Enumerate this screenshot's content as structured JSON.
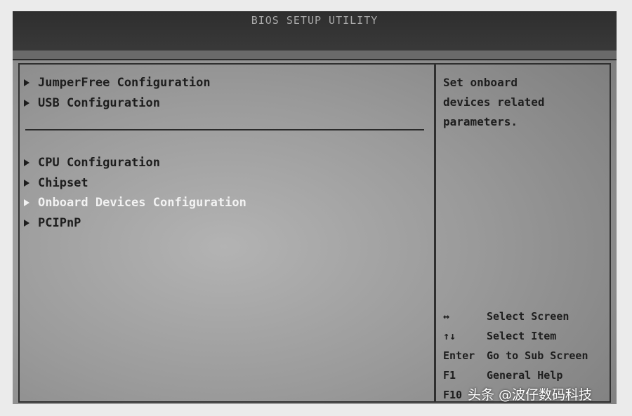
{
  "title": "BIOS SETUP UTILITY",
  "menu": {
    "group1": [
      {
        "label": "JumperFree Configuration"
      },
      {
        "label": "USB Configuration"
      }
    ],
    "group2": [
      {
        "label": "CPU Configuration"
      },
      {
        "label": "Chipset"
      },
      {
        "label": "Onboard Devices Configuration",
        "selected": true
      },
      {
        "label": "PCIPnP"
      }
    ]
  },
  "help": {
    "text": "Set onboard\ndevices related\nparameters."
  },
  "keys": [
    {
      "key": "↔",
      "action": "Select Screen"
    },
    {
      "key": "↑↓",
      "action": "Select Item"
    },
    {
      "key": "Enter",
      "action": "Go to Sub Screen"
    },
    {
      "key": "F1",
      "action": "General Help"
    },
    {
      "key": "F10",
      "action": ""
    }
  ],
  "watermark": "头条 @波仔数码科技",
  "colors": {
    "title_bar": "#2e2e2e",
    "screen": "#9a9a9a",
    "text": "#1e1e1e",
    "selected_text": "#f2f2f2"
  }
}
